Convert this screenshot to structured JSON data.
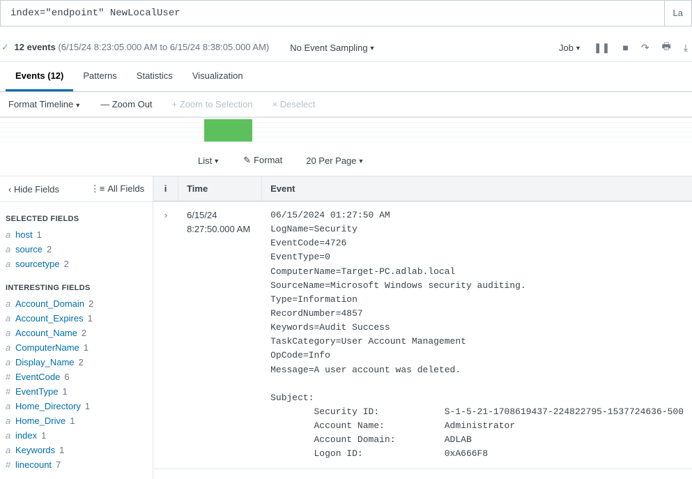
{
  "search": {
    "query": "index=\"endpoint\" NewLocalUser",
    "side_button": "La"
  },
  "results": {
    "check": "✓",
    "count_text": "12 events",
    "range_text": "(6/15/24 8:23:05.000 AM to 6/15/24 8:38:05.000 AM)",
    "sampling": "No Event Sampling",
    "job_label": "Job"
  },
  "tabs": {
    "events": "Events (12)",
    "patterns": "Patterns",
    "statistics": "Statistics",
    "visualization": "Visualization"
  },
  "timeline": {
    "format": "Format Timeline",
    "zoom_out": "— Zoom Out",
    "zoom_sel": "+ Zoom to Selection",
    "deselect": "× Deselect",
    "bar_left_pct": 29.5,
    "bar_width_pct": 7
  },
  "list_controls": {
    "list": "List",
    "format": "Format",
    "per_page": "20 Per Page"
  },
  "sidebar": {
    "hide": "Hide Fields",
    "all": "All Fields",
    "selected_title": "SELECTED FIELDS",
    "selected": [
      {
        "t": "a",
        "name": "host",
        "count": "1"
      },
      {
        "t": "a",
        "name": "source",
        "count": "2"
      },
      {
        "t": "a",
        "name": "sourcetype",
        "count": "2"
      }
    ],
    "interesting_title": "INTERESTING FIELDS",
    "interesting": [
      {
        "t": "a",
        "name": "Account_Domain",
        "count": "2"
      },
      {
        "t": "a",
        "name": "Account_Expires",
        "count": "1"
      },
      {
        "t": "a",
        "name": "Account_Name",
        "count": "2"
      },
      {
        "t": "a",
        "name": "ComputerName",
        "count": "1"
      },
      {
        "t": "a",
        "name": "Display_Name",
        "count": "2"
      },
      {
        "t": "#",
        "name": "EventCode",
        "count": "6"
      },
      {
        "t": "#",
        "name": "EventType",
        "count": "1"
      },
      {
        "t": "a",
        "name": "Home_Directory",
        "count": "1"
      },
      {
        "t": "a",
        "name": "Home_Drive",
        "count": "1"
      },
      {
        "t": "a",
        "name": "index",
        "count": "1"
      },
      {
        "t": "a",
        "name": "Keywords",
        "count": "1"
      },
      {
        "t": "#",
        "name": "linecount",
        "count": "7"
      }
    ]
  },
  "table": {
    "headers": {
      "i": "i",
      "time": "Time",
      "event": "Event"
    },
    "row": {
      "expand": "›",
      "time_date": "6/15/24",
      "time_time": "8:27:50.000 AM",
      "event_text": "06/15/2024 01:27:50 AM\nLogName=Security\nEventCode=4726\nEventType=0\nComputerName=Target-PC.adlab.local\nSourceName=Microsoft Windows security auditing.\nType=Information\nRecordNumber=4857\nKeywords=Audit Success\nTaskCategory=User Account Management\nOpCode=Info\nMessage=A user account was deleted.\n\nSubject:\n        Security ID:            S-1-5-21-1708619437-224822795-1537724636-500\n        Account Name:           Administrator\n        Account Domain:         ADLAB\n        Logon ID:               0xA666F8"
    }
  }
}
